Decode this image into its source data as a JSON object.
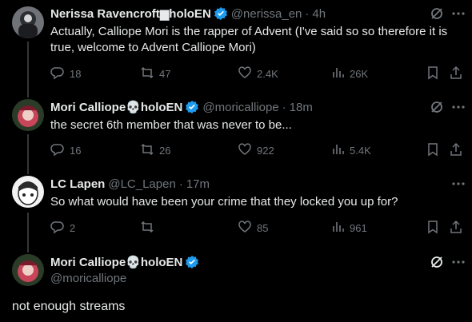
{
  "tweets": [
    {
      "display_name": "Nerissa Ravencroft",
      "badge_glyph": "▆",
      "name_suffix": "holoEN",
      "handle": "@nerissa_en",
      "dot": "·",
      "time": "4h",
      "text": "Actually, Calliope Mori is the rapper of Advent (I've said so so therefore it is true, welcome to Advent Calliope Mori)",
      "replies": "18",
      "reposts": "47",
      "likes": "2.4K",
      "views": "26K"
    },
    {
      "display_name": "Mori Calliope",
      "badge_glyph": "💀",
      "name_suffix": "holoEN",
      "handle": "@moricalliope",
      "dot": "·",
      "time": "18m",
      "text": "the secret 6th member that was never to be...",
      "replies": "16",
      "reposts": "26",
      "likes": "922",
      "views": "5.4K"
    },
    {
      "display_name": "LC Lapen",
      "handle": "@LC_Lapen",
      "dot": "·",
      "time": "17m",
      "text": "So what would have been your crime that they locked you up for?",
      "replies": "2",
      "reposts": "",
      "likes": "85",
      "views": "961"
    },
    {
      "display_name": "Mori Calliope",
      "badge_glyph": "💀",
      "name_suffix": "holoEN",
      "handle": "@moricalliope",
      "text": "not enough streams"
    }
  ],
  "colors": {
    "background": "#000000",
    "text": "#e7e9ea",
    "muted": "#71767b",
    "verified": "#1d9bf0",
    "thread_line": "#333639"
  }
}
